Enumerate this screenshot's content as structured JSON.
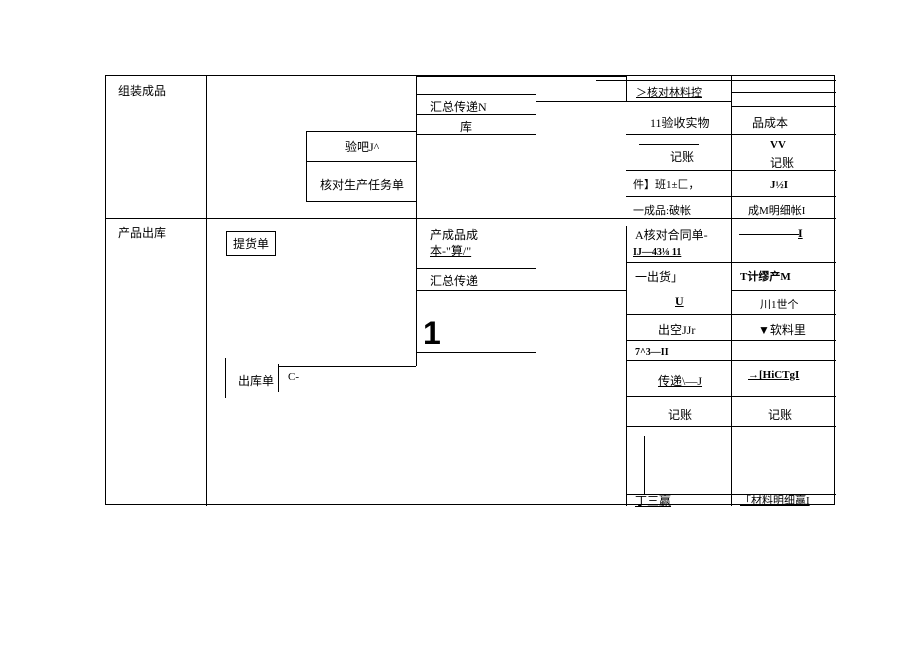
{
  "rows": {
    "r1": {
      "label": "组装成品"
    },
    "r2": {
      "label": "产品出库"
    }
  },
  "col2": {
    "tihuodan": "提货单",
    "chukudan": "出库单",
    "cminus": "C-"
  },
  "col3": {
    "yanba": "验吧J^",
    "hedui_shengchan": "核对生产任务单"
  },
  "col4": {
    "huizong_n": "汇总传递N",
    "ku": "库",
    "chengpin_cb_a": "产成品成",
    "chengpin_cb_b": "本-\"算/\"",
    "huizong_cd": "汇总传递",
    "big1": "1"
  },
  "col6": {
    "hedui_liaokong": "＞核对林料控",
    "yanshou": "11验收实物",
    "jizhang1": "记账",
    "jian_ban": "件】班1±匚，",
    "chengpin_zhang": "一成品:破帐",
    "a_hedui_ht": "A核对合同单-",
    "ij43": "IJ—43⅛    11",
    "chuhuo": "一出货」",
    "u": "U",
    "chukong": "出空JJr",
    "seven": "7^3—II",
    "chuandi": "传递\\—J",
    "jizhang2": "记账",
    "dingsanying": "丁三赢"
  },
  "col7": {
    "pin_chengben": "品成本",
    "vv": "VV",
    "jizhang1": "记账",
    "j12i": "J½I",
    "chengm_mx": "成M明细帐I",
    "i": "I",
    "t_ji": "T计缪产M",
    "chuan1shi": "川1世个",
    "ruankuanli": "▼软料里",
    "hictgi": "→[HiCTgI",
    "jizhang2": "记账",
    "cailiao_mx": "「材料明细赢I"
  }
}
